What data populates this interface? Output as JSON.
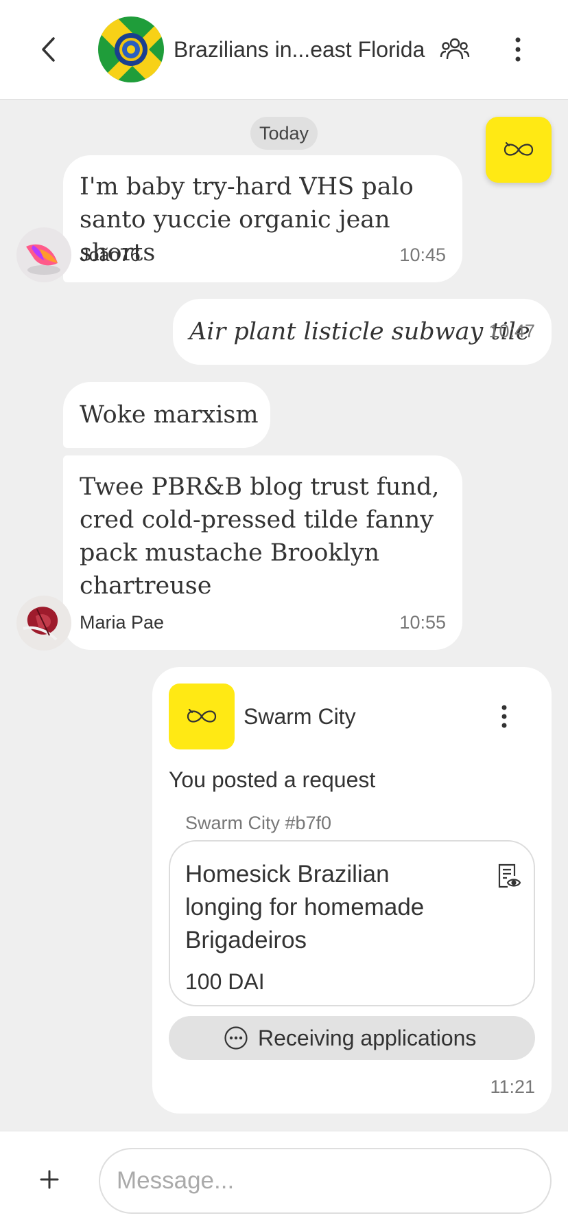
{
  "header": {
    "title": "Brazilians in...east Florida",
    "icons": {
      "back": "chevron-left-icon",
      "members": "group-icon",
      "menu": "more-vertical-icon"
    }
  },
  "date_divider": "Today",
  "messages": [
    {
      "author": "João76",
      "text": "I'm baby try-hard VHS palo santo yuccie organic jean shorts",
      "time": "10:45"
    },
    {
      "author": "",
      "text": "Air plant listicle subway tile",
      "time": "10:47",
      "own": true
    },
    {
      "author": "",
      "text": "Woke marxism",
      "time": ""
    },
    {
      "author": "Maria Pae",
      "text": "Twee PBR&B blog trust fund, cred cold-pressed tilde fanny pack mustache Brooklyn chartreuse",
      "time": "10:55"
    }
  ],
  "swarm_card": {
    "app_name": "Swarm City",
    "posted_text": "You posted a request",
    "reference": "Swarm City #b7f0",
    "request": {
      "title": "Homesick Brazilian longing for homemade Brigadeiros",
      "amount": "100 DAI"
    },
    "status": "Receiving applications",
    "time": "11:21"
  },
  "composer": {
    "placeholder": "Message..."
  },
  "colors": {
    "accent_yellow": "#ffe914",
    "background": "#efefef",
    "bubble": "#ffffff",
    "flag_green": "#1f9d3a",
    "flag_yellow": "#f7d117",
    "flag_blue": "#1a3f8f"
  }
}
